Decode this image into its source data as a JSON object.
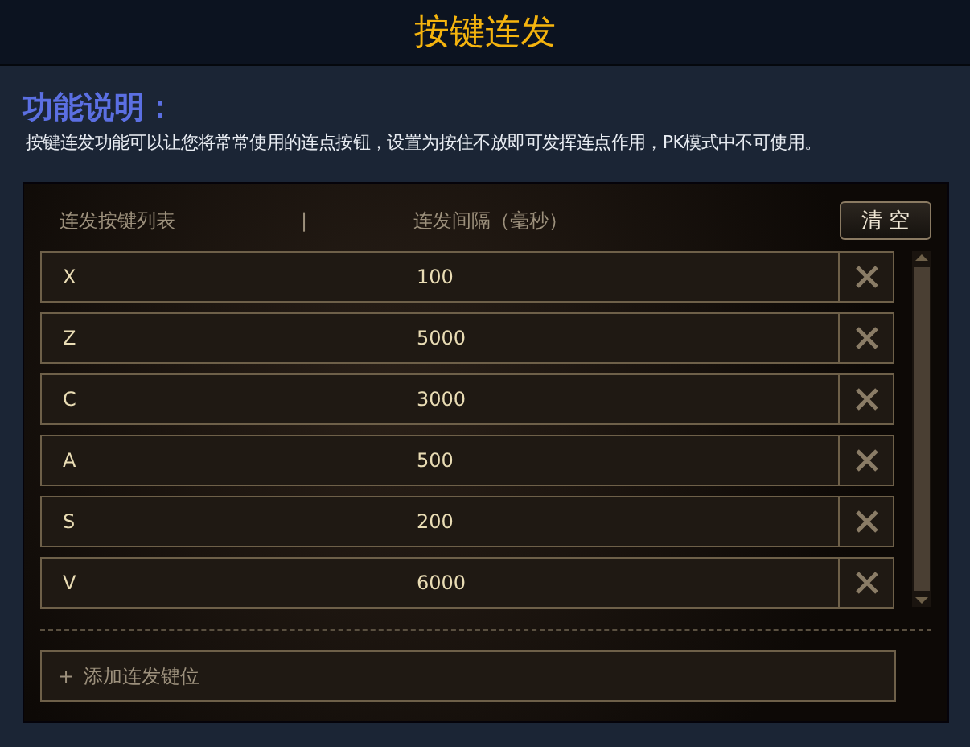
{
  "window": {
    "title": "按键连发"
  },
  "description": {
    "heading": "功能说明：",
    "text": "按键连发功能可以让您将常常使用的连点按钮，设置为按住不放即可发挥连点作用，PK模式中不可使用。"
  },
  "table": {
    "columns": [
      "连发按键列表",
      "|",
      "连发间隔（毫秒）"
    ],
    "clear_button": "清 空",
    "rows": [
      {
        "key": "X",
        "interval": "100"
      },
      {
        "key": "Z",
        "interval": "5000"
      },
      {
        "key": "C",
        "interval": "3000"
      },
      {
        "key": "A",
        "interval": "500"
      },
      {
        "key": "S",
        "interval": "200"
      },
      {
        "key": "V",
        "interval": "6000"
      }
    ]
  },
  "add_button": {
    "icon": "+",
    "label": "添加连发键位"
  }
}
